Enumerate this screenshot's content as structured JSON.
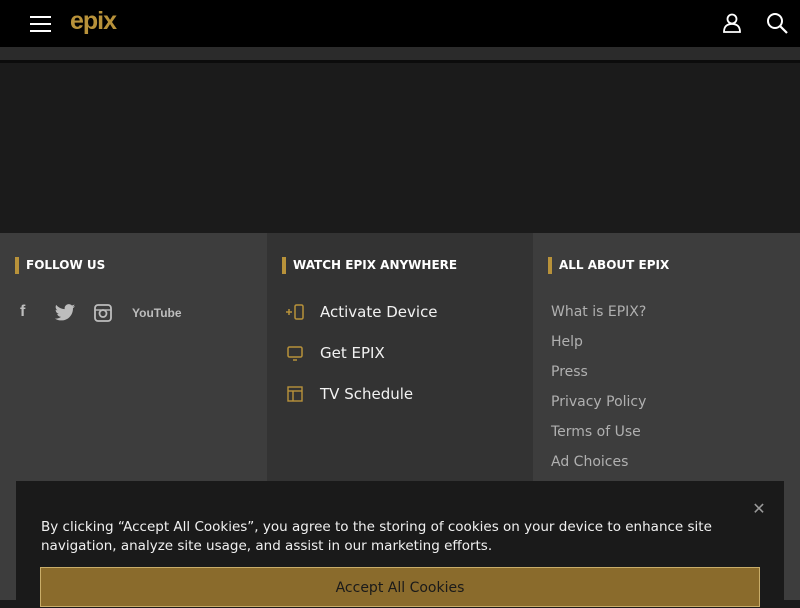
{
  "header": {
    "logo": "epix",
    "icons": [
      "hamburger-menu-icon",
      "user-icon",
      "search-icon"
    ]
  },
  "footer": {
    "follow_us": {
      "heading": "FOLLOW US",
      "social": [
        "facebook-icon",
        "twitter-icon",
        "instagram-icon",
        "youtube-icon"
      ],
      "facebook_glyph": "f",
      "youtube_text": "YouTube"
    },
    "watch": {
      "heading": "WATCH EPIX ANYWHERE",
      "items": [
        {
          "label": "Activate Device",
          "icon": "activate-device-icon"
        },
        {
          "label": "Get EPIX",
          "icon": "tv-icon"
        },
        {
          "label": "TV Schedule",
          "icon": "schedule-icon"
        }
      ]
    },
    "about": {
      "heading": "ALL ABOUT EPIX",
      "links": [
        "What is EPIX?",
        "Help",
        "Press",
        "Privacy Policy",
        "Terms of Use",
        "Ad Choices"
      ]
    }
  },
  "cookie_banner": {
    "text": "By clicking “Accept All Cookies”, you agree to the storing of cookies on your device to enhance site navigation, analyze site usage, and assist in our marketing efforts.",
    "close_glyph": "✕",
    "accept_label": "Accept All Cookies"
  },
  "colors": {
    "accent_gold": "#b8923a",
    "topbar": "#000000",
    "footer_light": "#3d3d3d",
    "footer_dark": "#333333",
    "banner": "#1a1a1a"
  }
}
